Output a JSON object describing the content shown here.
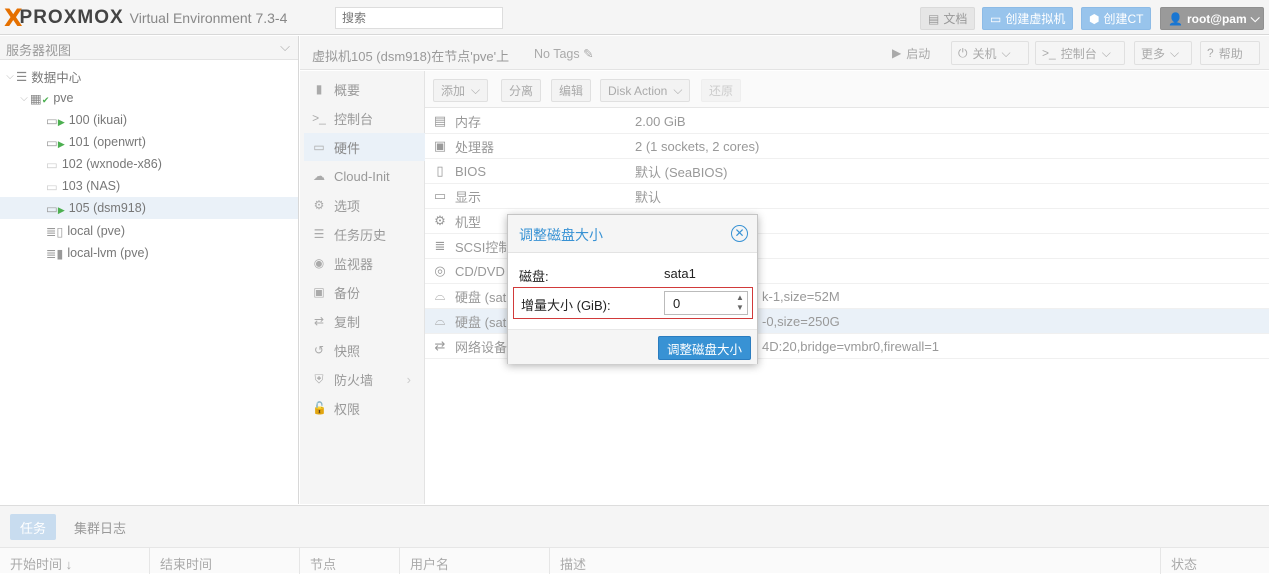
{
  "topbar": {
    "logo_x": "X",
    "logo_word": "PROXMOX",
    "version": "Virtual Environment 7.3-4",
    "search_placeholder": "搜索",
    "docs_label": "文档",
    "create_vm_label": "创建虚拟机",
    "create_ct_label": "创建CT",
    "user_label": "root@pam"
  },
  "tree": {
    "view_label": "服务器视图",
    "items": [
      {
        "label": "数据中心"
      },
      {
        "label": "pve"
      },
      {
        "label": "100 (ikuai)"
      },
      {
        "label": "101 (openwrt)"
      },
      {
        "label": "102 (wxnode-x86)"
      },
      {
        "label": "103 (NAS)"
      },
      {
        "label": "105 (dsm918)"
      },
      {
        "label": "local (pve)"
      },
      {
        "label": "local-lvm (pve)"
      }
    ]
  },
  "vmheader": {
    "title": "虚拟机105 (dsm918)在节点'pve'上",
    "no_tags": "No Tags",
    "start_label": "启动",
    "shutdown_label": "关机",
    "console_label": "控制台",
    "more_label": "更多",
    "help_label": "帮助"
  },
  "nav": {
    "items": [
      {
        "label": "概要"
      },
      {
        "label": "控制台"
      },
      {
        "label": "硬件"
      },
      {
        "label": "Cloud-Init"
      },
      {
        "label": "选项"
      },
      {
        "label": "任务历史"
      },
      {
        "label": "监视器"
      },
      {
        "label": "备份"
      },
      {
        "label": "复制"
      },
      {
        "label": "快照"
      },
      {
        "label": "防火墙"
      },
      {
        "label": "权限"
      }
    ]
  },
  "hwtoolbar": {
    "add_label": "添加",
    "detach_label": "分离",
    "edit_label": "编辑",
    "disk_action_label": "Disk Action",
    "revert_label": "还原"
  },
  "hardware": {
    "rows": [
      {
        "name": "内存",
        "value": "2.00 GiB"
      },
      {
        "name": "处理器",
        "value": "2 (1 sockets, 2 cores)"
      },
      {
        "name": "BIOS",
        "value": "默认 (SeaBIOS)"
      },
      {
        "name": "显示",
        "value": "默认"
      },
      {
        "name": "机型",
        "value": ""
      },
      {
        "name": "SCSI控制",
        "value": ""
      },
      {
        "name": "CD/DVD",
        "value": ""
      },
      {
        "name": "硬盘 (sat",
        "value": "k-1,size=52M"
      },
      {
        "name": "硬盘 (sat",
        "value": "-0,size=250G"
      },
      {
        "name": "网络设备",
        "value": "4D:20,bridge=vmbr0,firewall=1"
      }
    ]
  },
  "bottom": {
    "tasks_tab": "任务",
    "cluster_log_tab": "集群日志",
    "columns": [
      "开始时间 ↓",
      "结束时间",
      "节点",
      "用户名",
      "描述",
      "状态"
    ]
  },
  "dialog": {
    "title": "调整磁盘大小",
    "disk_label": "磁盘:",
    "disk_value": "sata1",
    "increment_label": "增量大小 (GiB):",
    "increment_value": "0",
    "ok_label": "调整磁盘大小"
  }
}
